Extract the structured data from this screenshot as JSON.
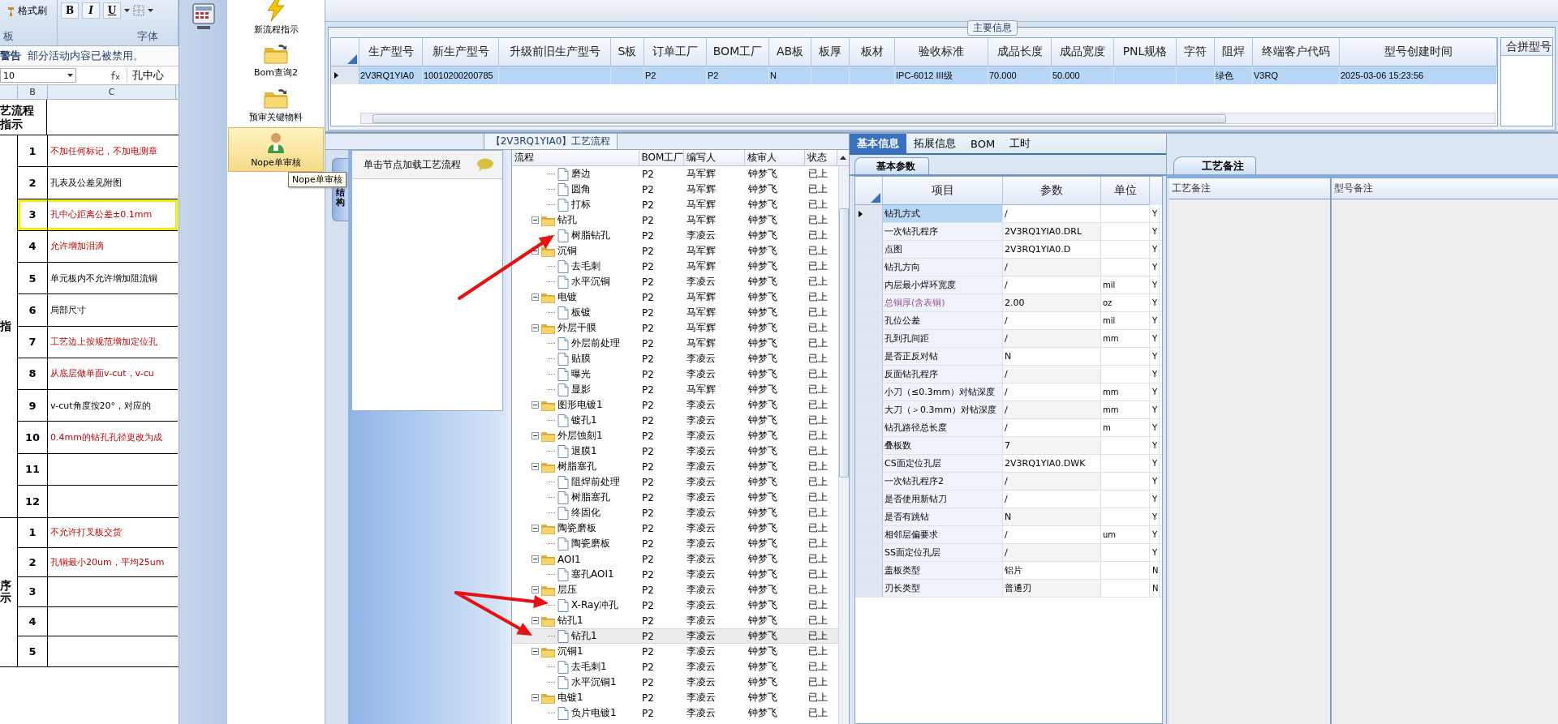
{
  "excel": {
    "ribbon": {
      "format_painter": "格式刷",
      "bold": "B",
      "italic": "I",
      "underline": "U",
      "group_clipboard": "板",
      "group_font": "字体"
    },
    "warning": {
      "title": "警告",
      "message": "部分活动内容已被禁用。"
    },
    "name_box": "10",
    "formula": "孔中心",
    "columns": [
      "B",
      "C"
    ],
    "header": "艺流程指示",
    "groups": [
      {
        "label": "指",
        "rows": [
          {
            "no": "1",
            "text": "不加任何标记，不加电测章",
            "kind": "emphasis",
            "highlighted": false
          },
          {
            "no": "2",
            "text": "孔表及公差见附图",
            "kind": "plain",
            "highlighted": false
          },
          {
            "no": "3",
            "text": "孔中心距离公差±0.1mm",
            "kind": "emphasis",
            "highlighted": true
          },
          {
            "no": "4",
            "text": "允许增加泪滴",
            "kind": "emphasis",
            "highlighted": false
          },
          {
            "no": "5",
            "text": "单元板内不允许增加阻流铜",
            "kind": "plain",
            "highlighted": false
          },
          {
            "no": "6",
            "text": "局部尺寸",
            "kind": "plain",
            "highlighted": false
          },
          {
            "no": "7",
            "text": "工艺边上按规范增加定位孔",
            "kind": "emphasis",
            "highlighted": false
          },
          {
            "no": "8",
            "text": "从底层做单面v-cut，v-cu",
            "kind": "emphasis",
            "highlighted": false
          },
          {
            "no": "9",
            "text": "v-cut角度按20°，对应的",
            "kind": "plain",
            "highlighted": false
          },
          {
            "no": "10",
            "text": "0.4mm的钻孔孔径更改为成",
            "kind": "emphasis",
            "highlighted": false
          },
          {
            "no": "11",
            "highlighted": false
          },
          {
            "no": "12",
            "highlighted": false
          }
        ]
      },
      {
        "label": "序示",
        "rows": [
          {
            "no": "1",
            "text": "不允许打叉板交货",
            "kind": "emphasis",
            "highlighted": false
          },
          {
            "no": "2",
            "text": "孔铜最小20um，平均25um",
            "kind": "emphasis",
            "highlighted": false
          },
          {
            "no": "3",
            "highlighted": false
          },
          {
            "no": "4",
            "highlighted": false
          },
          {
            "no": "5",
            "highlighted": false
          }
        ]
      }
    ]
  },
  "nav": [
    {
      "label": "新流程指示",
      "kind": "lightning",
      "selected": false
    },
    {
      "label": "Bom查询2",
      "kind": "folder",
      "selected": false
    },
    {
      "label": "预审关键物料",
      "kind": "folder",
      "selected": false
    },
    {
      "label": "Nope单审核",
      "kind": "person",
      "selected": true
    }
  ],
  "tooltip": "Nope单审核",
  "main_info": {
    "title": "主要信息",
    "columns": [
      "生产型号",
      "新生产型号",
      "升级前旧生产型号",
      "S板",
      "订单工厂",
      "BOM工厂",
      "AB板",
      "板厚",
      "板材",
      "验收标准",
      "成品长度",
      "成品宽度",
      "PNL规格",
      "字符",
      "阻焊",
      "终端客户代码",
      "型号创建时间"
    ],
    "rows": [
      {
        "selected": true,
        "cells": [
          "2V3RQ1YIA0",
          "10010200200785",
          null,
          null,
          "P2",
          "P2",
          "N",
          null,
          null,
          "IPC-6012 III级",
          "70.000",
          "50.000",
          null,
          null,
          "绿色",
          "V3RQ",
          "2025-03-06 15:23:56"
        ]
      }
    ],
    "merge_panel": {
      "title": "合拼型号"
    }
  },
  "process": {
    "title": "【2V3RQ1YIA0】工艺流程",
    "side_tab": "结构",
    "hint": "单击节点加载工艺流程",
    "columns": [
      "流程",
      "BOM工厂",
      "编写人",
      "核审人",
      "状态"
    ],
    "tree": [
      {
        "children": [
          {
            "kind": "item",
            "name": "磨边",
            "factory": "P2",
            "writer": "马军辉",
            "reviewer": "钟梦飞",
            "status": "已上",
            "selected": false
          },
          {
            "kind": "item",
            "name": "圆角",
            "factory": "P2",
            "writer": "马军辉",
            "reviewer": "钟梦飞",
            "status": "已上",
            "selected": false
          },
          {
            "kind": "item",
            "name": "打标",
            "factory": "P2",
            "writer": "马军辉",
            "reviewer": "钟梦飞",
            "status": "已上",
            "selected": false
          }
        ]
      },
      {
        "kind": "folder",
        "name": "钻孔",
        "factory": "P2",
        "writer": "马军辉",
        "reviewer": "钟梦飞",
        "status": "已上",
        "selected": false,
        "expanded": true,
        "children": [
          {
            "kind": "item",
            "name": "树脂钻孔",
            "factory": "P2",
            "writer": "李凌云",
            "reviewer": "钟梦飞",
            "status": "已上",
            "selected": false
          }
        ]
      },
      {
        "kind": "folder",
        "name": "沉铜",
        "factory": "P2",
        "writer": "马军辉",
        "reviewer": "钟梦飞",
        "status": "已上",
        "selected": false,
        "expanded": true,
        "children": [
          {
            "kind": "item",
            "name": "去毛刺",
            "factory": "P2",
            "writer": "马军辉",
            "reviewer": "钟梦飞",
            "status": "已上",
            "selected": false
          },
          {
            "kind": "item",
            "name": "水平沉铜",
            "factory": "P2",
            "writer": "李凌云",
            "reviewer": "钟梦飞",
            "status": "已上",
            "selected": false
          }
        ]
      },
      {
        "kind": "folder",
        "name": "电镀",
        "factory": "P2",
        "writer": "马军辉",
        "reviewer": "钟梦飞",
        "status": "已上",
        "selected": false,
        "expanded": true,
        "children": [
          {
            "kind": "item",
            "name": "板镀",
            "factory": "P2",
            "writer": "马军辉",
            "reviewer": "钟梦飞",
            "status": "已上",
            "selected": false
          }
        ]
      },
      {
        "kind": "folder",
        "name": "外层干膜",
        "factory": "P2",
        "writer": "马军辉",
        "reviewer": "钟梦飞",
        "status": "已上",
        "selected": false,
        "expanded": true,
        "children": [
          {
            "kind": "item",
            "name": "外层前处理",
            "factory": "P2",
            "writer": "马军辉",
            "reviewer": "钟梦飞",
            "status": "已上",
            "selected": false
          },
          {
            "kind": "item",
            "name": "贴膜",
            "factory": "P2",
            "writer": "李凌云",
            "reviewer": "钟梦飞",
            "status": "已上",
            "selected": false
          },
          {
            "kind": "item",
            "name": "曝光",
            "factory": "P2",
            "writer": "李凌云",
            "reviewer": "钟梦飞",
            "status": "已上",
            "selected": false
          },
          {
            "kind": "item",
            "name": "显影",
            "factory": "P2",
            "writer": "马军辉",
            "reviewer": "钟梦飞",
            "status": "已上",
            "selected": false
          }
        ]
      },
      {
        "kind": "folder",
        "name": "图形电镀1",
        "factory": "P2",
        "writer": "李凌云",
        "reviewer": "钟梦飞",
        "status": "已上",
        "selected": false,
        "expanded": true,
        "children": [
          {
            "kind": "item",
            "name": "镀孔1",
            "factory": "P2",
            "writer": "李凌云",
            "reviewer": "钟梦飞",
            "status": "已上",
            "selected": false
          }
        ]
      },
      {
        "kind": "folder",
        "name": "外层蚀刻1",
        "factory": "P2",
        "writer": "李凌云",
        "reviewer": "钟梦飞",
        "status": "已上",
        "selected": false,
        "expanded": true,
        "children": [
          {
            "kind": "item",
            "name": "退膜1",
            "factory": "P2",
            "writer": "李凌云",
            "reviewer": "钟梦飞",
            "status": "已上",
            "selected": false
          }
        ]
      },
      {
        "kind": "folder",
        "name": "树脂塞孔",
        "factory": "P2",
        "writer": "李凌云",
        "reviewer": "钟梦飞",
        "status": "已上",
        "selected": false,
        "expanded": true,
        "children": [
          {
            "kind": "item",
            "name": "阻焊前处理",
            "factory": "P2",
            "writer": "李凌云",
            "reviewer": "钟梦飞",
            "status": "已上",
            "selected": false
          },
          {
            "kind": "item",
            "name": "树脂塞孔",
            "factory": "P2",
            "writer": "李凌云",
            "reviewer": "钟梦飞",
            "status": "已上",
            "selected": false
          },
          {
            "kind": "item",
            "name": "终固化",
            "factory": "P2",
            "writer": "李凌云",
            "reviewer": "钟梦飞",
            "status": "已上",
            "selected": false
          }
        ]
      },
      {
        "kind": "folder",
        "name": "陶瓷磨板",
        "factory": "P2",
        "writer": "李凌云",
        "reviewer": "钟梦飞",
        "status": "已上",
        "selected": false,
        "expanded": true,
        "children": [
          {
            "kind": "item",
            "name": "陶瓷磨板",
            "factory": "P2",
            "writer": "李凌云",
            "reviewer": "钟梦飞",
            "status": "已上",
            "selected": false
          }
        ]
      },
      {
        "kind": "folder",
        "name": "AOI1",
        "factory": "P2",
        "writer": "李凌云",
        "reviewer": "钟梦飞",
        "status": "已上",
        "selected": false,
        "expanded": true,
        "children": [
          {
            "kind": "item",
            "name": "塞孔AOI1",
            "factory": "P2",
            "writer": "李凌云",
            "reviewer": "钟梦飞",
            "status": "已上",
            "selected": false
          }
        ]
      },
      {
        "kind": "folder",
        "name": "层压",
        "factory": "P2",
        "writer": "李凌云",
        "reviewer": "钟梦飞",
        "status": "已上",
        "selected": false,
        "expanded": true,
        "children": [
          {
            "kind": "item",
            "name": "X-Ray冲孔",
            "factory": "P2",
            "writer": "李凌云",
            "reviewer": "钟梦飞",
            "status": "已上",
            "selected": false
          }
        ]
      },
      {
        "kind": "folder",
        "name": "钻孔1",
        "factory": "P2",
        "writer": "李凌云",
        "reviewer": "钟梦飞",
        "status": "已上",
        "selected": false,
        "expanded": true,
        "children": [
          {
            "kind": "item",
            "name": "钻孔1",
            "factory": "P2",
            "writer": "李凌云",
            "reviewer": "钟梦飞",
            "status": "已上",
            "selected": true
          }
        ]
      },
      {
        "kind": "folder",
        "name": "沉铜1",
        "factory": "P2",
        "writer": "李凌云",
        "reviewer": "钟梦飞",
        "status": "已上",
        "selected": false,
        "expanded": true,
        "children": [
          {
            "kind": "item",
            "name": "去毛刺1",
            "factory": "P2",
            "writer": "李凌云",
            "reviewer": "钟梦飞",
            "status": "已上",
            "selected": false
          },
          {
            "kind": "item",
            "name": "水平沉铜1",
            "factory": "P2",
            "writer": "李凌云",
            "reviewer": "钟梦飞",
            "status": "已上",
            "selected": false
          }
        ]
      },
      {
        "kind": "folder",
        "name": "电镀1",
        "factory": "P2",
        "writer": "李凌云",
        "reviewer": "钟梦飞",
        "status": "已上",
        "selected": false,
        "expanded": true,
        "children": [
          {
            "kind": "item",
            "name": "负片电镀1",
            "factory": "P2",
            "writer": "李凌云",
            "reviewer": "钟梦飞",
            "status": "已上",
            "selected": false
          }
        ]
      }
    ]
  },
  "params": {
    "tabs": [
      {
        "label": "基本信息",
        "selected": true
      },
      {
        "label": "拓展信息",
        "selected": false
      },
      {
        "label": "BOM",
        "selected": false
      },
      {
        "label": "工时",
        "selected": false
      }
    ],
    "subtab": "基本参数",
    "columns": [
      "项目",
      "参数",
      "单位"
    ],
    "rows": [
      {
        "item": "钻孔方式",
        "value": "/",
        "flag": "Y",
        "kind": "input",
        "selected": true
      },
      {
        "item": "一次钻孔程序",
        "value": "2V3RQ1YIA0.DRL",
        "flag": "Y",
        "kind": "input",
        "selected": false
      },
      {
        "item": "点图",
        "value": "2V3RQ1YIA0.D",
        "flag": "Y",
        "kind": "input",
        "selected": false
      },
      {
        "item": "钻孔方向",
        "value": "/",
        "flag": "Y",
        "kind": "input",
        "selected": false
      },
      {
        "item": "内层最小焊环宽度",
        "value": "/",
        "unit": "mil",
        "flag": "Y",
        "kind": "input",
        "selected": false
      },
      {
        "item": "总铜厚(含表铜)",
        "value": "2.00",
        "unit": "oz",
        "flag": "Y",
        "kind": "derived",
        "selected": false
      },
      {
        "item": "孔位公差",
        "value": "/",
        "unit": "mil",
        "flag": "Y",
        "kind": "input",
        "selected": false
      },
      {
        "item": "孔到孔间距",
        "value": "/",
        "unit": "mm",
        "flag": "Y",
        "kind": "input",
        "selected": false
      },
      {
        "item": "是否正反对钻",
        "value": "N",
        "flag": "Y",
        "kind": "input",
        "selected": false
      },
      {
        "item": "反面钻孔程序",
        "value": "/",
        "flag": "Y",
        "kind": "input",
        "selected": false
      },
      {
        "item": "小刀（≤0.3mm）对钻深度",
        "value": "/",
        "unit": "mm",
        "flag": "Y",
        "kind": "input",
        "selected": false
      },
      {
        "item": "大刀（＞0.3mm）对钻深度",
        "value": "/",
        "unit": "mm",
        "flag": "Y",
        "kind": "input",
        "selected": false
      },
      {
        "item": "钻孔路径总长度",
        "value": "/",
        "unit": "m",
        "flag": "Y",
        "kind": "input",
        "selected": false
      },
      {
        "item": "叠板数",
        "value": "7",
        "flag": "Y",
        "kind": "input",
        "selected": false
      },
      {
        "item": "CS面定位孔层",
        "value": "2V3RQ1YIA0.DWK",
        "flag": "Y",
        "kind": "input",
        "selected": false
      },
      {
        "item": "一次钻孔程序2",
        "value": "/",
        "flag": "Y",
        "kind": "input",
        "selected": false
      },
      {
        "item": "是否使用新钻刀",
        "value": "/",
        "flag": "Y",
        "kind": "input",
        "selected": false
      },
      {
        "item": "是否有跳钻",
        "value": "N",
        "flag": "Y",
        "kind": "input",
        "selected": false
      },
      {
        "item": "相邻层偏要求",
        "value": "/",
        "unit": "um",
        "flag": "Y",
        "kind": "input",
        "selected": false
      },
      {
        "item": "SS面定位孔层",
        "value": "/",
        "flag": "Y",
        "kind": "input",
        "selected": false
      },
      {
        "item": "盖板类型",
        "value": "铝片",
        "flag": "N",
        "kind": "input",
        "selected": false
      },
      {
        "item": "刃长类型",
        "value": "普通刃",
        "flag": "N",
        "kind": "input",
        "selected": false
      }
    ]
  },
  "notes": {
    "tab": "工艺备注",
    "columns": [
      "工艺备注",
      "型号备注"
    ]
  }
}
